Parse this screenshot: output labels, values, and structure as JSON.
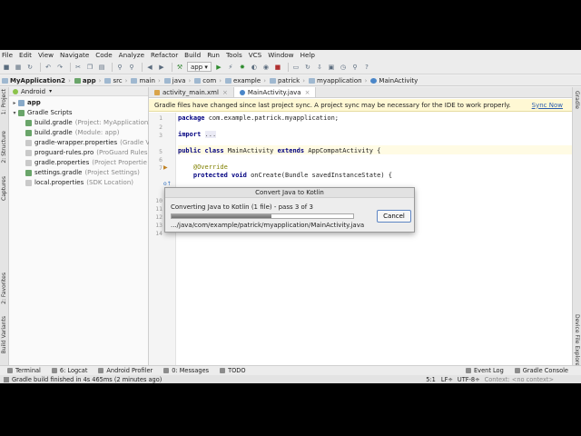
{
  "menu": [
    "File",
    "Edit",
    "View",
    "Navigate",
    "Code",
    "Analyze",
    "Refactor",
    "Build",
    "Run",
    "Tools",
    "VCS",
    "Window",
    "Help"
  ],
  "toolbar": {
    "run_config": "app"
  },
  "breadcrumb": [
    "MyApplication2",
    "app",
    "src",
    "main",
    "java",
    "com",
    "example",
    "patrick",
    "myapplication",
    "MainActivity"
  ],
  "project_panel": {
    "view": "Android",
    "tree": [
      {
        "label": "app",
        "hint": "",
        "icon": "folder"
      },
      {
        "label": "Gradle Scripts",
        "hint": "",
        "icon": "gradle"
      },
      {
        "label": "build.gradle",
        "hint": "(Project: MyApplication2)",
        "icon": "gradle"
      },
      {
        "label": "build.gradle",
        "hint": "(Module: app)",
        "icon": "gradle"
      },
      {
        "label": "gradle-wrapper.properties",
        "hint": "(Gradle V",
        "icon": "file"
      },
      {
        "label": "proguard-rules.pro",
        "hint": "(ProGuard Rules",
        "icon": "file"
      },
      {
        "label": "gradle.properties",
        "hint": "(Project Propertie",
        "icon": "file"
      },
      {
        "label": "settings.gradle",
        "hint": "(Project Settings)",
        "icon": "gradle"
      },
      {
        "label": "local.properties",
        "hint": "(SDK Location)",
        "icon": "file"
      }
    ]
  },
  "tabs": [
    {
      "label": "activity_main.xml",
      "active": false
    },
    {
      "label": "MainActivity.java",
      "active": true
    }
  ],
  "notice": {
    "text": "Gradle files have changed since last project sync. A project sync may be necessary for the IDE to work properly.",
    "action": "Sync Now"
  },
  "editor": {
    "line_numbers": [
      "1",
      "2",
      "3",
      "",
      "5",
      "6",
      "7",
      "",
      "",
      "10",
      "11",
      "12",
      "13",
      "14"
    ],
    "lines": [
      {
        "text": "package com.example.patrick.myapplication;"
      },
      {
        "text": ""
      },
      {
        "text": "import ..."
      },
      {
        "text": ""
      },
      {
        "text": "public class MainActivity extends AppCompatActivity {"
      },
      {
        "text": ""
      },
      {
        "text": "    @Override"
      },
      {
        "text": "    protected void onCreate(Bundle savedInstanceState) {"
      }
    ]
  },
  "dialog": {
    "title": "Convert Java to Kotlin",
    "status": "Converting Java to Kotlin (1 file) - pass 3 of 3",
    "progress": 0.55,
    "path": ".../java/com/example/patrick/myapplication/MainActivity.java",
    "cancel": "Cancel"
  },
  "left_tabs": [
    "1: Project",
    "2: Structure",
    "Captures",
    "2: Favorites",
    "Build Variants"
  ],
  "right_tabs": [
    "Gradle",
    "Device File Explorer"
  ],
  "tool_windows": [
    "Terminal",
    "6: Logcat",
    "Android Profiler",
    "0: Messages",
    "TODO"
  ],
  "tool_windows_right": [
    "Event Log",
    "Gradle Console"
  ],
  "status_bar": {
    "message": "Gradle build finished in 4s 465ms (2 minutes ago)",
    "position": "5:1",
    "line_sep": "LF÷",
    "encoding": "UTF-8÷",
    "context": "Context: <no context>"
  }
}
